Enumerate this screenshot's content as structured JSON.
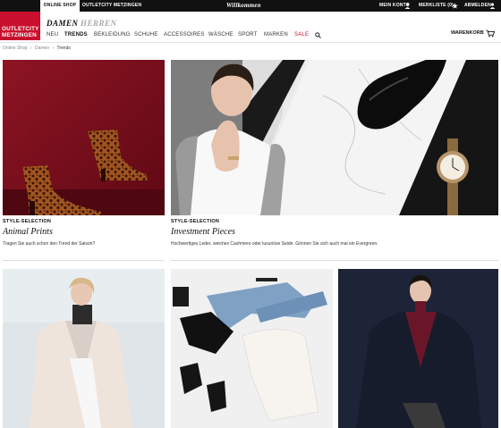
{
  "topbar": {
    "online_shop": "ONLINE SHOP",
    "outletcity": "OUTLETCITY METZINGEN",
    "willkommen": "Willkommen",
    "mein_konto": "MEIN KONTO",
    "merkliste": "MERKLISTE (0)",
    "abmelden": "ABMELDEN"
  },
  "logo": {
    "line1": "OUTLETCITY",
    "line2": "METZINGEN",
    "brand_color": "#c8102e"
  },
  "gender": {
    "damen": "DAMEN",
    "herren": "HERREN"
  },
  "nav": {
    "items": [
      "NEU",
      "TRENDS",
      "BEKLEIDUNG",
      "SCHUHE",
      "ACCESSOIRES",
      "WÄSCHE",
      "SPORT",
      "MARKEN",
      "SALE"
    ],
    "active": "TRENDS",
    "sale_color": "#c8102e",
    "search_icon": "search-icon"
  },
  "basket": {
    "label": "WARENKORB"
  },
  "breadcrumb": [
    "Online Shop",
    "›",
    "Damen",
    "›",
    "Trends"
  ],
  "tiles": [
    {
      "kicker": "STYLE-SELECTION",
      "title": "Animal Prints",
      "text": "Tragen Sie auch schon den Trend der Saison?"
    },
    {
      "kicker": "STYLE-SELECTION",
      "title": "Investment Pieces",
      "text": "Hochwertiges Leder, weiches Cashmere oder luxuriöse Seide. Gönnen Sie sich auch mal ein Evergreen."
    }
  ]
}
